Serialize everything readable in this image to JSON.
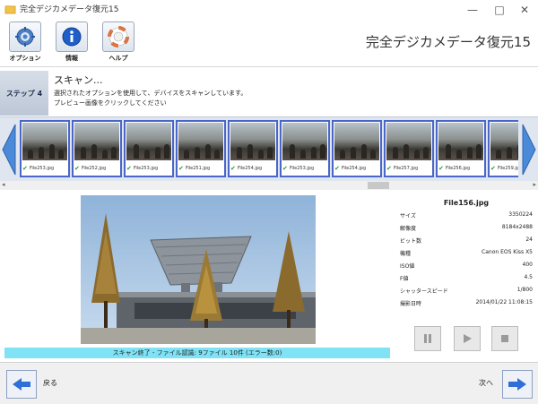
{
  "window": {
    "title": "完全デジカメデータ復元15",
    "icon": "folder-icon",
    "controls": [
      "—",
      "□",
      "✕"
    ]
  },
  "toolbar": {
    "buttons": [
      {
        "label": "オプション",
        "icon": "gear-icon"
      },
      {
        "label": "情報",
        "icon": "info-icon"
      },
      {
        "label": "ヘルプ",
        "icon": "lifebuoy-icon"
      }
    ],
    "app_title": "完全デジカメデータ復元15"
  },
  "step": {
    "badge": "ステップ 4",
    "title": "スキャン...",
    "desc_line1": "選択されたオプションを使用して、デバイスをスキャンしています。",
    "desc_line2": "プレビュー画像をクリックしてください"
  },
  "thumbnails": [
    {
      "name": "File253.jpg",
      "checked": true
    },
    {
      "name": "File252.jpg",
      "checked": true
    },
    {
      "name": "File253.jpg",
      "checked": true
    },
    {
      "name": "File251.jpg",
      "checked": true
    },
    {
      "name": "File254.jpg",
      "checked": true
    },
    {
      "name": "File253.jpg",
      "checked": true
    },
    {
      "name": "File254.jpg",
      "checked": true
    },
    {
      "name": "File257.jpg",
      "checked": true
    },
    {
      "name": "File256.jpg",
      "checked": true
    },
    {
      "name": "File259.jpg",
      "checked": true
    }
  ],
  "preview": {
    "filename": "File156.jpg",
    "status": "スキャン終了 - ファイル認識: 9ファイル 10件 (エラー数:0)"
  },
  "properties": [
    {
      "key": "サイズ",
      "value": "3350224"
    },
    {
      "key": "解像度",
      "value": "8184x2488"
    },
    {
      "key": "ビット数",
      "value": "24"
    },
    {
      "key": "機種",
      "value": "Canon EOS Kiss X5"
    },
    {
      "key": "ISO値",
      "value": "400"
    },
    {
      "key": "F値",
      "value": "4.5"
    },
    {
      "key": "シャッタースピード",
      "value": "1/800"
    },
    {
      "key": "撮影日時",
      "value": "2014/01/22 11:08:15"
    }
  ],
  "media_controls": [
    "pause-icon",
    "play-icon",
    "stop-icon"
  ],
  "nav": {
    "back_label": "戻る",
    "next_label": "次へ"
  },
  "colors": {
    "accent": "#2f6fd6",
    "status_bar": "#7fe3f5",
    "thumb_border": "#4a66c8"
  }
}
